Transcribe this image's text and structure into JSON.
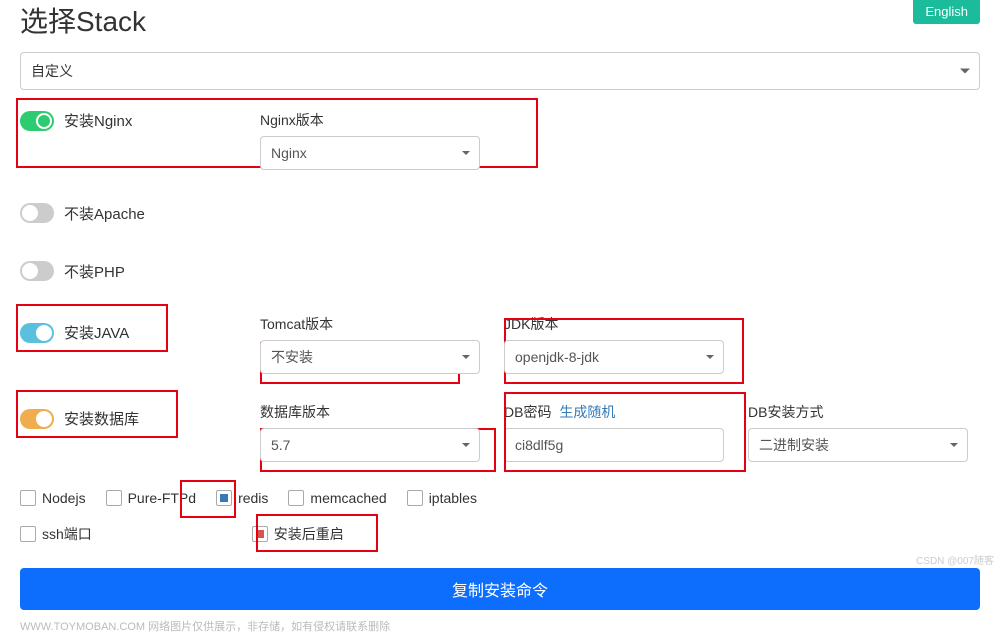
{
  "header": {
    "title": "选择Stack",
    "lang_btn": "English"
  },
  "top_select": {
    "value": "自定义"
  },
  "rows": {
    "nginx": {
      "toggle_label": "安装Nginx",
      "field_label": "Nginx版本",
      "value": "Nginx"
    },
    "apache": {
      "toggle_label": "不装Apache"
    },
    "php": {
      "toggle_label": "不装PHP"
    },
    "java": {
      "toggle_label": "安装JAVA",
      "tomcat_label": "Tomcat版本",
      "tomcat_value": "不安装",
      "jdk_label": "JDK版本",
      "jdk_value": "openjdk-8-jdk"
    },
    "db": {
      "toggle_label": "安装数据库",
      "ver_label": "数据库版本",
      "ver_value": "5.7",
      "pwd_label": "DB密码",
      "pwd_link": "生成随机",
      "pwd_value": "ci8dlf5g",
      "method_label": "DB安装方式",
      "method_value": "二进制安装"
    }
  },
  "checkboxes1": {
    "nodejs": "Nodejs",
    "pureftpd": "Pure-FTPd",
    "redis": "redis",
    "memcached": "memcached",
    "iptables": "iptables"
  },
  "checkboxes2": {
    "ssh": "ssh端口",
    "reboot": "安装后重启"
  },
  "copy_btn": "复制安装命令",
  "footer": "WWW.TOYMOBAN.COM   网络图片仅供展示，非存储，如有侵权请联系删除",
  "watermark": "CSDN @007随客"
}
